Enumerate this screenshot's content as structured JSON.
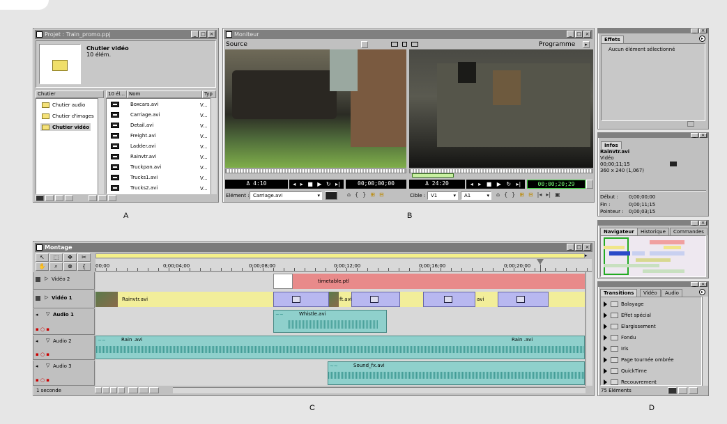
{
  "labels": {
    "a": "A",
    "b": "B",
    "c": "C",
    "d": "D"
  },
  "project": {
    "title": "Projet : Train_promo.ppj",
    "bin_name": "Chutier vidéo",
    "bin_count": "10 élém.",
    "col_bin": "Chutier",
    "col_count": "10 él...",
    "col_name": "Nom",
    "col_type": "Typ",
    "bins": [
      "Chutier audio",
      "Chutier d'images",
      "Chutier vidéo"
    ],
    "files": [
      {
        "name": "Boxcars.avi",
        "type": "V..."
      },
      {
        "name": "Carriage.avi",
        "type": "V..."
      },
      {
        "name": "Detail.avi",
        "type": "V..."
      },
      {
        "name": "Freight.avi",
        "type": "V..."
      },
      {
        "name": "Ladder.avi",
        "type": "V..."
      },
      {
        "name": "Rainvtr.avi",
        "type": "V..."
      },
      {
        "name": "Truckpan.avi",
        "type": "V..."
      },
      {
        "name": "Trucks1.avi",
        "type": "V..."
      },
      {
        "name": "Trucks2.avi",
        "type": "V..."
      }
    ]
  },
  "monitor": {
    "title": "Moniteur",
    "source_label": "Source",
    "program_label": "Programme",
    "source_duration": "Δ 4:10",
    "source_tc": "00;00;00;00",
    "program_duration": "Δ 24:20",
    "program_tc": "00;00;20;29",
    "element_label": "Elément :",
    "element_value": "Carriage.avi",
    "target_label": "Cible :",
    "target_v": "V1",
    "target_a": "A1"
  },
  "effects": {
    "title": "Effets",
    "empty_text": "Aucun élément sélectionné"
  },
  "info": {
    "tab": "Infos",
    "clip": "Rainvtr.avi",
    "kind": "Vidéo",
    "timecode": "00;00;11;15",
    "dims": "360 x 240 (1,067)",
    "start_label": "Début :",
    "start_val": "0;00;00;00",
    "end_label": "Fin :",
    "end_val": "0;00;11;15",
    "cursor_label": "Pointeur :",
    "cursor_val": "0;00;03;15"
  },
  "navigator": {
    "tabs": [
      "Navigateur",
      "Historique",
      "Commandes"
    ]
  },
  "transitions": {
    "tabs": [
      "Transitions",
      "Vidéo",
      "Audio"
    ],
    "items": [
      "Balayage",
      "Effet spécial",
      "Elargissement",
      "Fondu",
      "Iris",
      "Page tournée ombrée",
      "QuickTime",
      "Recouvrement"
    ],
    "count": "75 Eléments"
  },
  "timeline": {
    "title": "Montage",
    "ruler": [
      "00;00",
      "0;00;04;00",
      "0;00;08;00",
      "0;00;12;00",
      "0;00;16;00",
      "0;00;20;00"
    ],
    "zoom_label": "1 seconde",
    "tracks": {
      "video2": "Vidéo 2",
      "video1": "Vidéo 1",
      "audio1": "Audio 1",
      "audio2": "Audio 2",
      "audio3": "Audio 3"
    },
    "clips": {
      "timetable": "timetable.ptl",
      "rainvtr": "Rainvtr.avi",
      "video1_b": "ft.avi",
      "video1_c": "avi",
      "whistle": "Whistle.avi",
      "rain_a": "Rain .avi",
      "rain_b": "Rain .avi",
      "sound": "Sound_fx.avi"
    }
  },
  "colors": {
    "timetable": "#e88a8a",
    "video_clip": "#f2ee9a",
    "transition": "#b8b8f0",
    "audio": "#8fd0cc",
    "waveform": "#2f8f88"
  }
}
